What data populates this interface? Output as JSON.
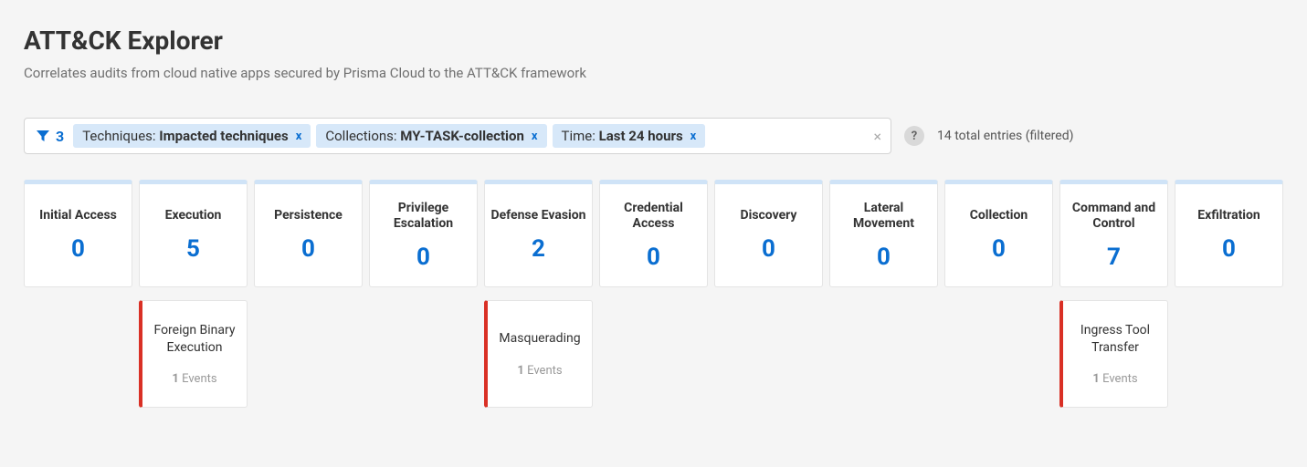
{
  "header": {
    "title": "ATT&CK Explorer",
    "subtitle": "Correlates audits from cloud native apps secured by Prisma Cloud to the ATT&CK framework"
  },
  "filters": {
    "count": "3",
    "chips": [
      {
        "label": "Techniques:",
        "value": "Impacted techniques"
      },
      {
        "label": "Collections:",
        "value": "MY-TASK-collection"
      },
      {
        "label": "Time:",
        "value": "Last 24 hours"
      }
    ],
    "clear_icon": "×",
    "chip_close": "x"
  },
  "help_icon": "?",
  "entries_text": "14 total entries (filtered)",
  "events_suffix": "Events",
  "tactics": [
    {
      "name": "Initial Access",
      "count": "0",
      "techniques": []
    },
    {
      "name": "Execution",
      "count": "5",
      "techniques": [
        {
          "name": "Foreign Binary Execution",
          "events": "1"
        }
      ]
    },
    {
      "name": "Persistence",
      "count": "0",
      "techniques": []
    },
    {
      "name": "Privilege Escalation",
      "count": "0",
      "techniques": []
    },
    {
      "name": "Defense Evasion",
      "count": "2",
      "techniques": [
        {
          "name": "Masquerading",
          "events": "1"
        }
      ]
    },
    {
      "name": "Credential Access",
      "count": "0",
      "techniques": []
    },
    {
      "name": "Discovery",
      "count": "0",
      "techniques": []
    },
    {
      "name": "Lateral Movement",
      "count": "0",
      "techniques": []
    },
    {
      "name": "Collection",
      "count": "0",
      "techniques": []
    },
    {
      "name": "Command and Control",
      "count": "7",
      "techniques": [
        {
          "name": "Ingress Tool Transfer",
          "events": "1"
        }
      ]
    },
    {
      "name": "Exfiltration",
      "count": "0",
      "techniques": []
    }
  ]
}
